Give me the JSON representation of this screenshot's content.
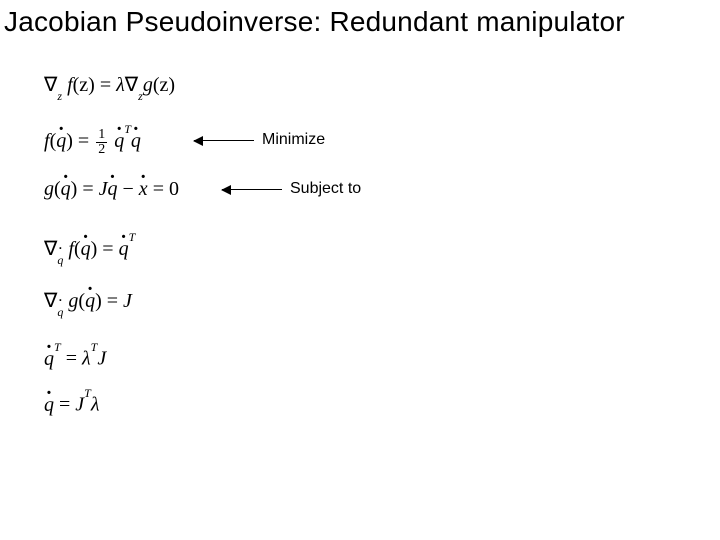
{
  "title": "Jacobian Pseudoinverse: Redundant manipulator",
  "labels": {
    "minimize": "Minimize",
    "subject_to": "Subject to"
  },
  "equations": {
    "eq1_lhs_nabla": "∇",
    "eq1_lhs_sub": "z",
    "eq1_lhs_fn": "f",
    "eq1_lhs_arg": "(z)",
    "eq1_eq": " = ",
    "eq1_rhs_lambda": "λ",
    "eq1_rhs_nabla": "∇",
    "eq1_rhs_sub": "z",
    "eq1_rhs_fn": "g",
    "eq1_rhs_arg": "(z)",
    "eq2_lhs_fn": "f",
    "eq2_lhs_arg_q": "q",
    "eq2_eq": " = ",
    "eq2_frac_num": "1",
    "eq2_frac_den": "2",
    "eq2_q1": "q",
    "eq2_sup": "T",
    "eq2_q2": "q",
    "eq3_lhs_fn": "g",
    "eq3_lhs_arg_q": "q",
    "eq3_eq": " = ",
    "eq3_J": "J",
    "eq3_q": "q",
    "eq3_minus": " − ",
    "eq3_x": "x",
    "eq3_zero": " = 0",
    "eq4_nabla": "∇",
    "eq4_sub": "q",
    "eq4_fn": "f",
    "eq4_arg_q": "q",
    "eq4_eq": " = ",
    "eq4_q": "q",
    "eq4_sup": "T",
    "eq5_nabla": "∇",
    "eq5_sub": "q",
    "eq5_fn": "g",
    "eq5_arg_q": "q",
    "eq5_eq": " = ",
    "eq5_J": "J",
    "eq6_q": "q",
    "eq6_sup": "T",
    "eq6_eq": " = ",
    "eq6_lambda": "λ",
    "eq6_lsup": "T",
    "eq6_J": "J",
    "eq7_q": "q",
    "eq7_eq": " = ",
    "eq7_J": "J",
    "eq7_sup": "T",
    "eq7_lambda": "λ"
  }
}
